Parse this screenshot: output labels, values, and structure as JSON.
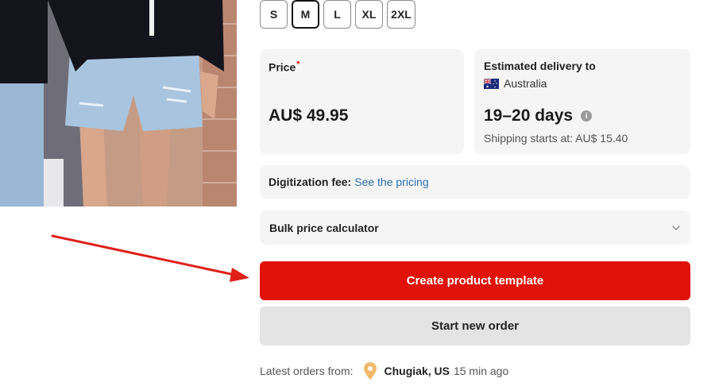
{
  "sizes": {
    "options": [
      "S",
      "M",
      "L",
      "XL",
      "2XL"
    ],
    "selected": "M"
  },
  "price": {
    "label": "Price",
    "required_mark": "*",
    "value": "AU$ 49.95"
  },
  "delivery": {
    "label": "Estimated delivery to",
    "country": "Australia",
    "flag_icon": "australia-flag-icon",
    "days": "19–20 days",
    "info_icon": "info-icon",
    "shipping": "Shipping starts at: AU$ 15.40"
  },
  "digitization": {
    "label": "Digitization fee:",
    "link": "See the pricing"
  },
  "bulk": {
    "label": "Bulk price calculator",
    "icon": "chevron-down-icon"
  },
  "actions": {
    "primary": "Create product template",
    "secondary": "Start new order"
  },
  "latest_orders": {
    "label": "Latest orders from:",
    "pin_icon": "location-pin-icon",
    "location": "Chugiak, US",
    "time": "15 min ago"
  },
  "colors": {
    "primary_button": "#e01209",
    "secondary_button": "#e4e4e4",
    "card_background": "#f5f5f5",
    "link": "#2a6fb0",
    "annotation_arrow": "#e0201a"
  }
}
